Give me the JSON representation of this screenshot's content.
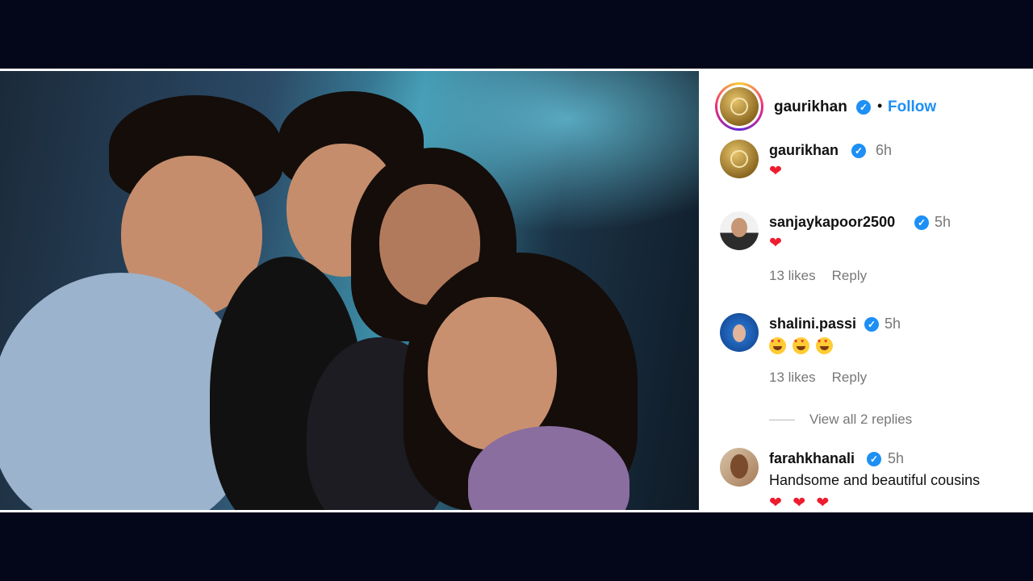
{
  "header": {
    "username": "gaurikhan",
    "separator": "•",
    "follow_label": "Follow",
    "verified_glyph": "✓"
  },
  "comments": [
    {
      "username": "gaurikhan",
      "time": "6h",
      "text": "❤",
      "avatar": "gold-monogram-avatar"
    },
    {
      "username": "sanjaykapoor2500",
      "time": "5h",
      "text": "❤",
      "likes": "13 likes",
      "reply": "Reply",
      "avatar": "man-sunglasses-avatar"
    },
    {
      "username": "shalini.passi",
      "time": "5h",
      "emoji": "heart-eyes-emoji",
      "emoji_count": 3,
      "likes": "13 likes",
      "reply": "Reply",
      "avatar": "woman-blue-avatar"
    },
    {
      "username": "farahkhanali",
      "time": "5h",
      "text": "Handsome and beautiful cousins",
      "hearts": "❤ ❤ ❤",
      "avatar": "woman-selfie-avatar"
    }
  ],
  "view_replies": "View all 2 replies",
  "colors": {
    "background": "#04071a",
    "accent": "#1d8ff5",
    "heart": "#ed1c2e",
    "muted": "#777777"
  }
}
